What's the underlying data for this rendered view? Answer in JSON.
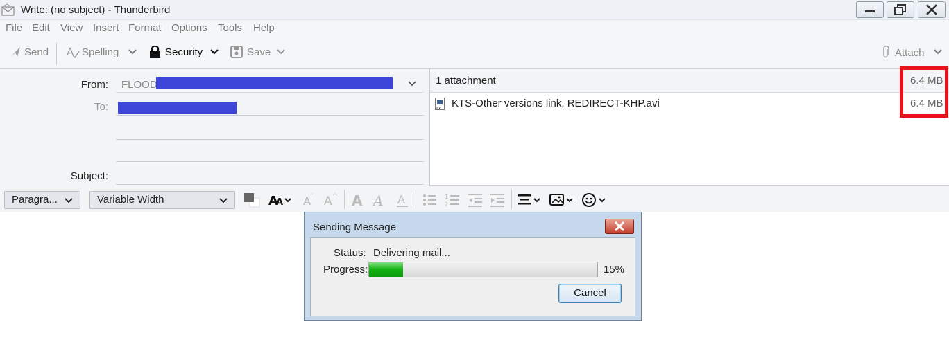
{
  "window": {
    "title": "Write: (no subject) - Thunderbird"
  },
  "menu": [
    "File",
    "Edit",
    "View",
    "Insert",
    "Format",
    "Options",
    "Tools",
    "Help"
  ],
  "toolbar": {
    "send": "Send",
    "spelling": "Spelling",
    "security": "Security",
    "save": "Save",
    "attach": "Attach"
  },
  "header": {
    "from_label": "From:",
    "from_value": "FLOOD",
    "to_label": "To:",
    "subject_label": "Subject:"
  },
  "attachments": {
    "count_label": "1 attachment",
    "total_size": "6.4 MB",
    "items": [
      {
        "name": "KTS-Other versions link, REDIRECT-KHP.avi",
        "size": "6.4 MB",
        "icon": "avi-file-icon"
      }
    ]
  },
  "format": {
    "paragraph": "Paragra...",
    "font": "Variable Width"
  },
  "dialog": {
    "title": "Sending Message",
    "status_label": "Status:",
    "status_value": "Delivering mail...",
    "progress_label": "Progress:",
    "progress_percent": "15%",
    "progress_fraction": 0.15,
    "cancel": "Cancel"
  },
  "colors": {
    "redaction": "#3d46d9",
    "highlight": "#e8121b",
    "progress_green": "#11b211"
  }
}
